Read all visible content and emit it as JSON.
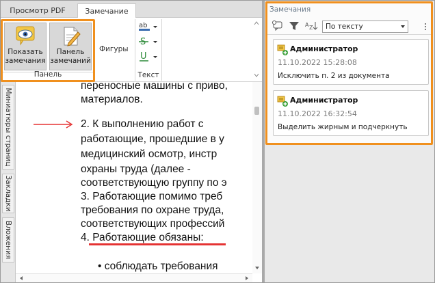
{
  "tabs": [
    {
      "label": "Просмотр PDF"
    },
    {
      "label": "Замечание"
    }
  ],
  "ribbon": {
    "show_comments": "Показать замечания",
    "show_comments_line1": "Показать",
    "show_comments_line2": "замечания",
    "comments_panel_line1": "Панель",
    "comments_panel_line2": "замечаний",
    "group_panel_label": "Панель",
    "shapes_label": "Фигуры",
    "text_group_label": "Текст",
    "text_tools": [
      "highlight-text-icon",
      "strikethrough-icon",
      "underline-icon"
    ]
  },
  "side_tabs": {
    "thumbnails": "Миниатюры страниц",
    "bookmarks": "Закладки",
    "attachments": "Вложения"
  },
  "document": {
    "lines": [
      "переносные машины с приво,",
      "материалов.",
      "2. К    выполнению    работ    с",
      "работающие, прошедшие в у",
      "медицинский  осмотр,  инстр",
      "охраны   труда   (далее   -",
      "соответствующую группу по э",
      "3. Работающие  помимо  треб",
      "требования по охране труда,",
      "соответствующих профессий",
      "4. Работающие обязаны:",
      "•      соблюдать требования"
    ]
  },
  "comments_panel": {
    "title": "Замечания",
    "sort_label": "По тексту",
    "comments": [
      {
        "author": "Администратор",
        "date": "11.10.2022 15:28:08",
        "text": "Исключить п. 2 из документа"
      },
      {
        "author": "Администратор",
        "date": "11.10.2022 16:32:54",
        "text": "Выделить жирным и подчеркнуть"
      }
    ]
  },
  "colors": {
    "highlight_border": "#f0901e",
    "annotation_red": "#e53333"
  }
}
